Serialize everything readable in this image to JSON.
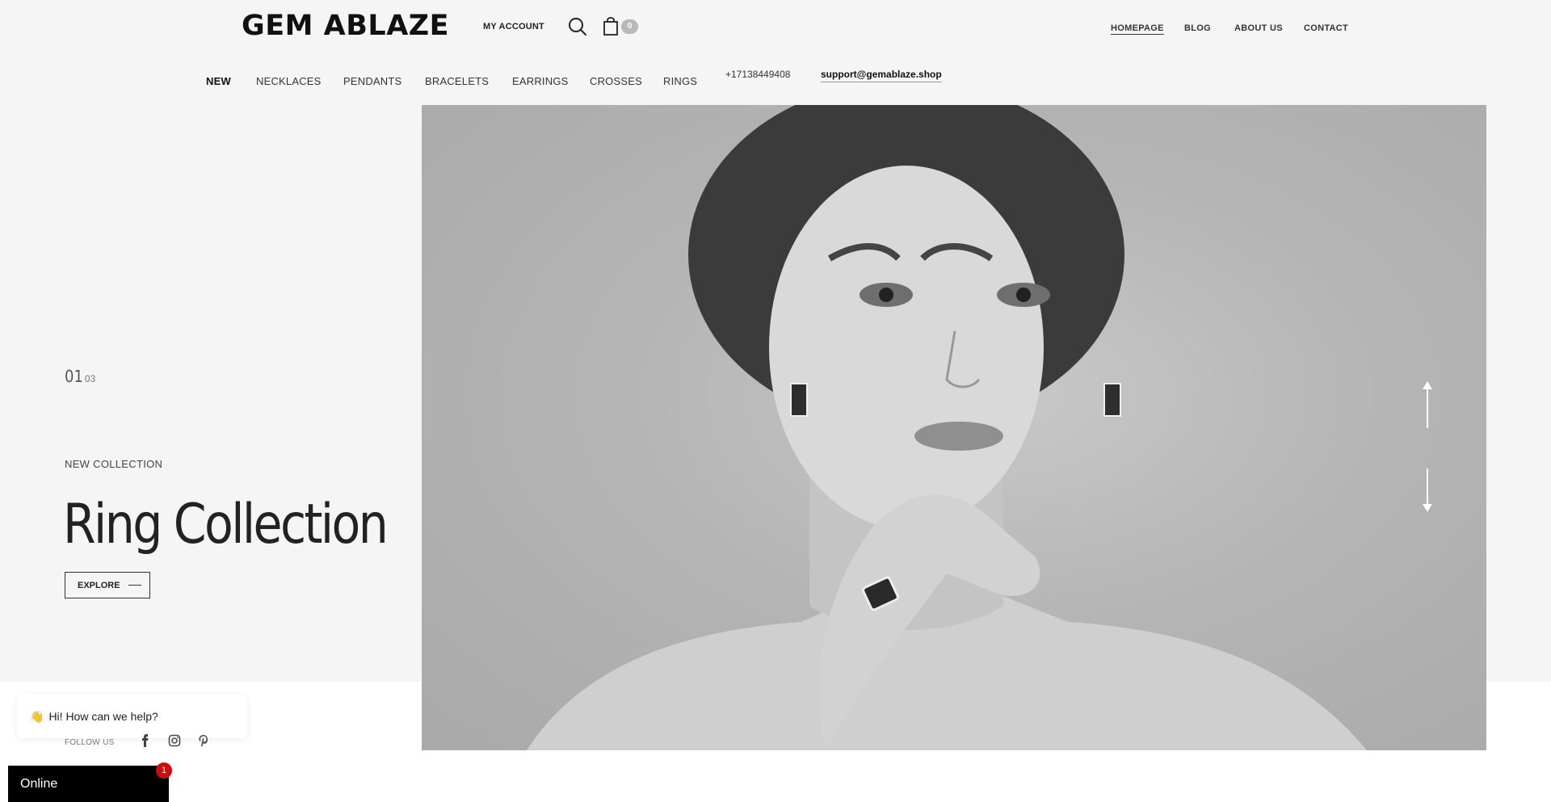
{
  "header": {
    "logo": "GEM ABLAZE",
    "my_account": "MY ACCOUNT",
    "cart_count": "0",
    "nav": [
      "HOMEPAGE",
      "BLOG",
      "ABOUT US",
      "CONTACT"
    ]
  },
  "categories": [
    "NEW",
    "NECKLACES",
    "PENDANTS",
    "BRACELETS",
    "EARRINGS",
    "CROSSES",
    "RINGS"
  ],
  "contact": {
    "phone": "+17138449408",
    "email": "support@gemablaze.shop"
  },
  "hero": {
    "slide_current": "01",
    "slide_total": "03",
    "eyebrow": "NEW COLLECTION",
    "title": "Ring Collection",
    "button": "EXPLORE"
  },
  "footer": {
    "follow_label": "FOLLOW US",
    "social": [
      "facebook-icon",
      "instagram-icon",
      "pinterest-icon"
    ]
  },
  "chat": {
    "greeting": "Hi! How can we help?",
    "status": "Online",
    "unread": "1"
  }
}
